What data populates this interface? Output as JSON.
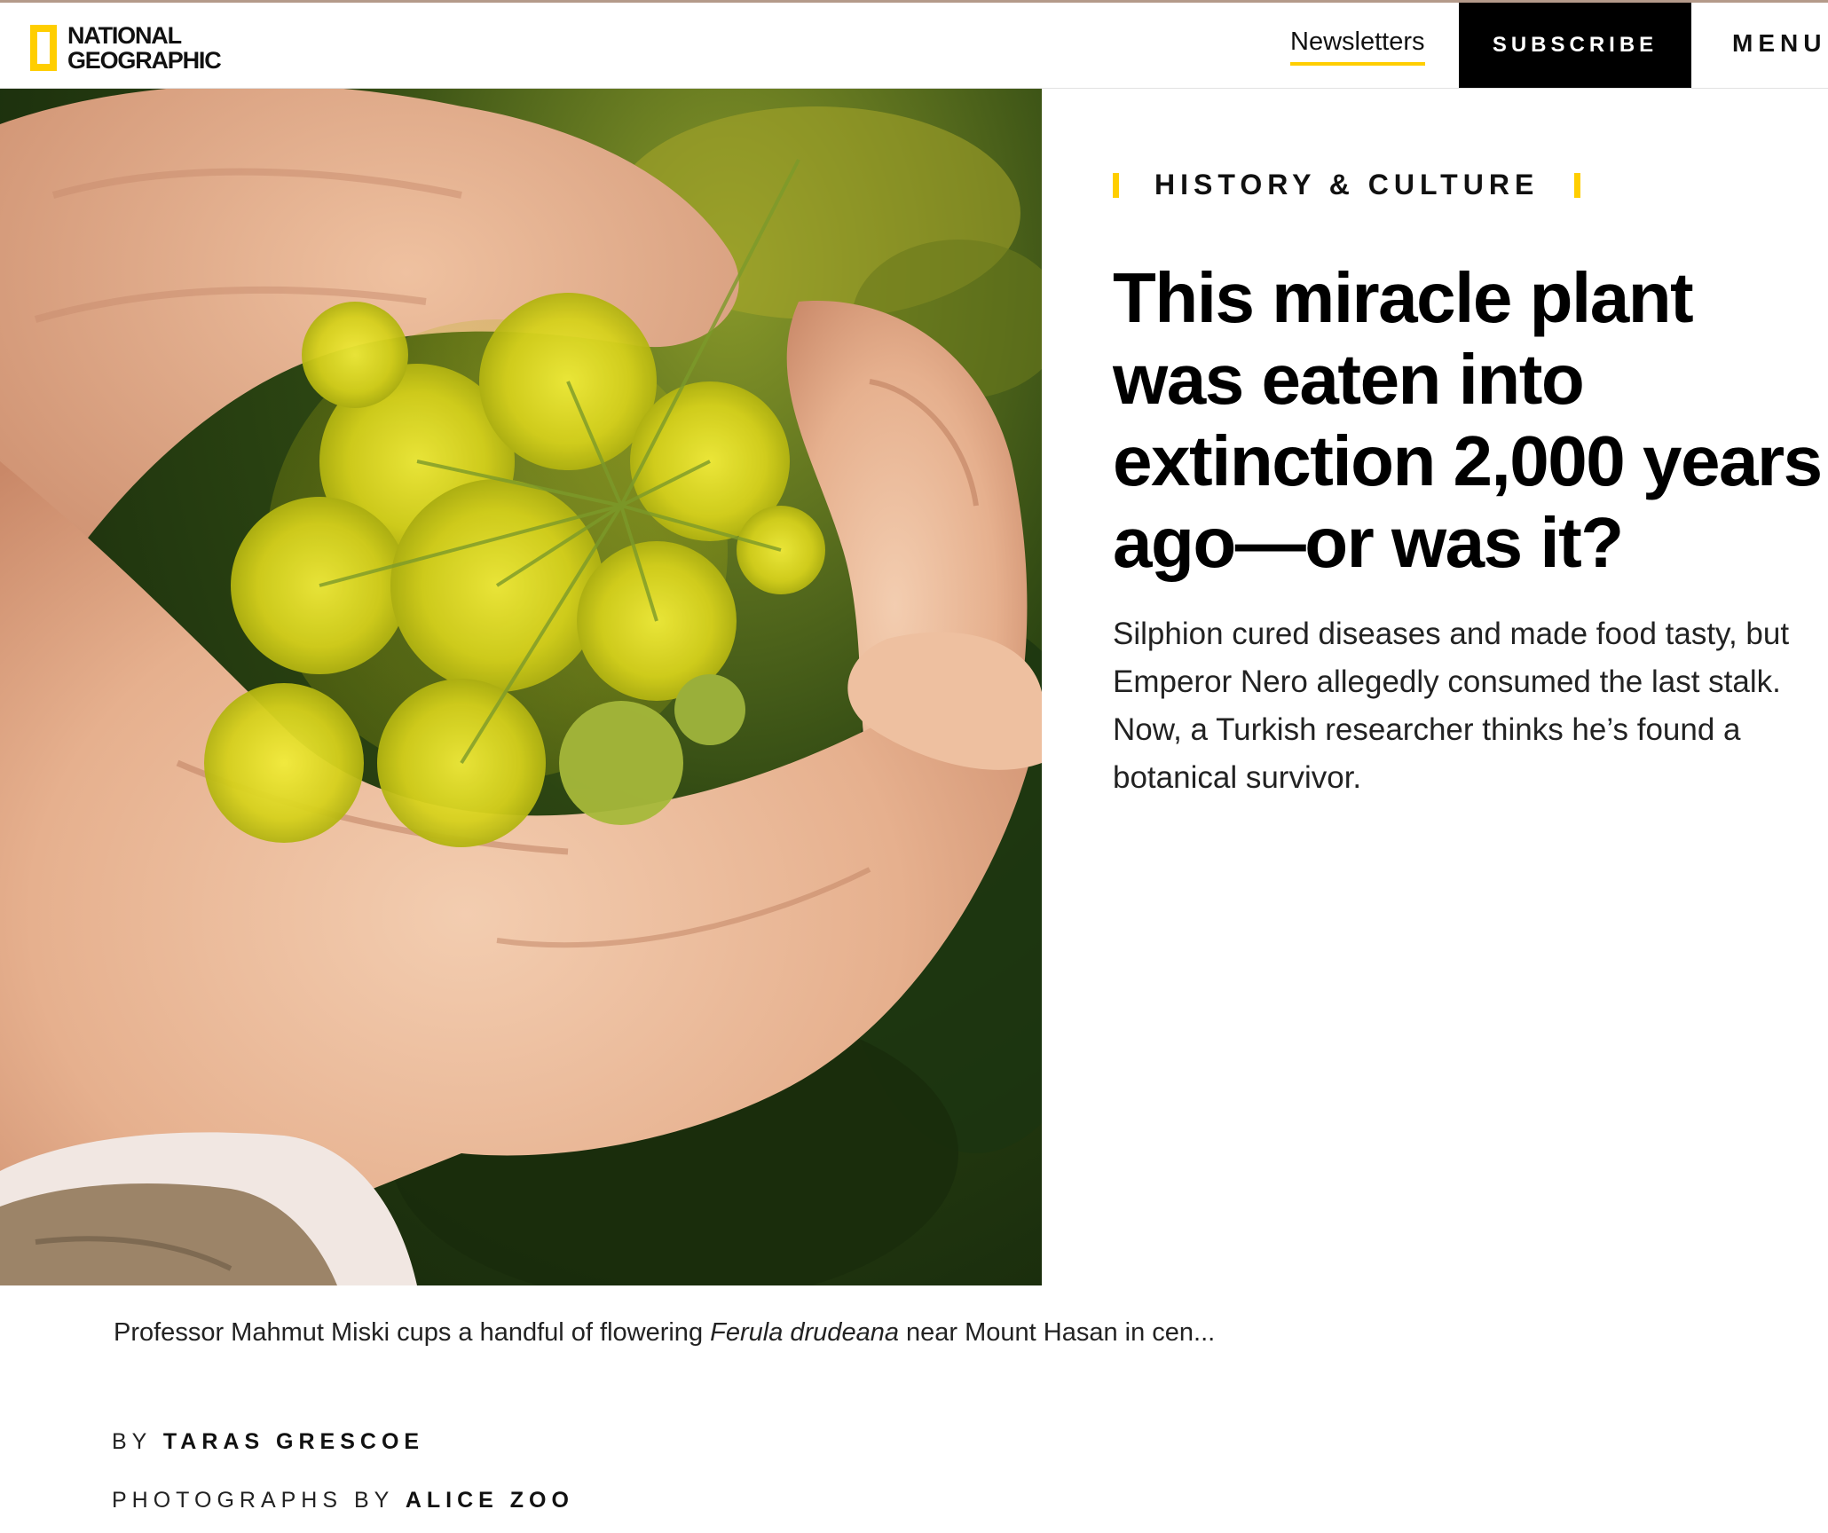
{
  "brand": {
    "logo_line1": "NATIONAL",
    "logo_line2": "GEOGRAPHIC",
    "accent": "#ffce00"
  },
  "nav": {
    "newsletters": "Newsletters",
    "subscribe": "SUBSCRIBE",
    "menu": "MENU"
  },
  "hero": {
    "image": "hands-cupping-yellow-flowers-photo"
  },
  "article": {
    "kicker": "HISTORY & CULTURE",
    "headline": "This miracle plant was eaten into extinction 2,000 years ago—or was it?",
    "dek": "Silphion cured diseases and made food tasty, but Emperor Nero allegedly consumed the last stalk. Now, a Turkish researcher thinks he’s found a botanical survivor.",
    "caption_before": "Professor Mahmut Miski cups a handful of flowering ",
    "caption_italic": "Ferula drudeana",
    "caption_after": " near Mount Hasan in cen...",
    "byline_prefix": "BY",
    "author": "TARAS GRESCOE",
    "photos_prefix": "PHOTOGRAPHS BY",
    "photographer": "ALICE ZOO"
  }
}
